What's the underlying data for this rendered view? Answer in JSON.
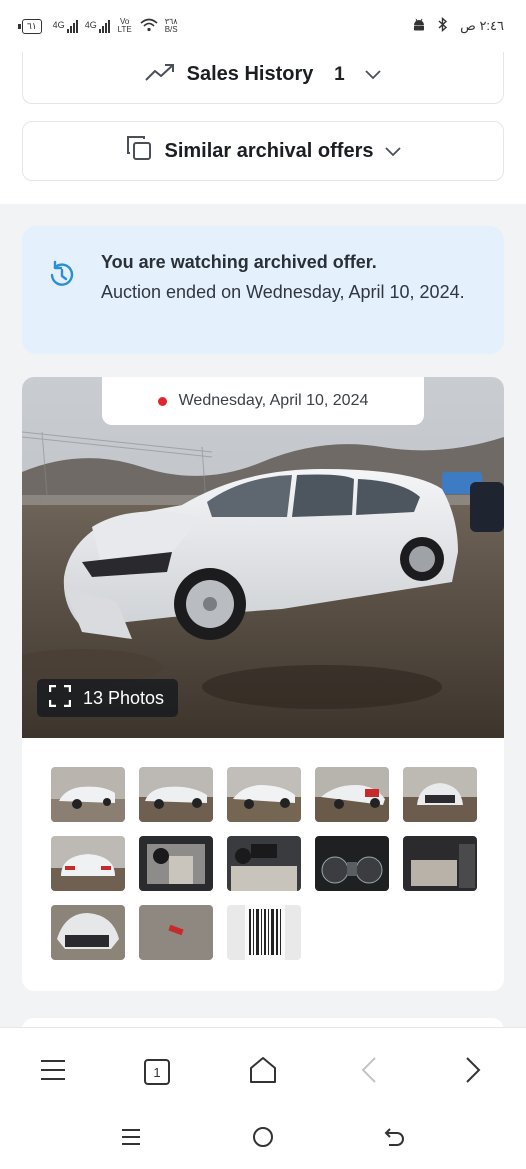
{
  "status_bar": {
    "battery": "٦١",
    "network_1": "4G",
    "network_2": "4G",
    "volte": "Vo LTE",
    "data_speed": "٣٦٨",
    "data_unit": "B/S",
    "time": "٢:٤٦ ص"
  },
  "accordion": {
    "sales_history_label": "Sales History",
    "sales_history_count": "1",
    "similar_offers_label": "Similar archival offers"
  },
  "notice": {
    "title": "You are watching archived offer.",
    "text": "Auction ended on Wednesday, April 10, 2024."
  },
  "gallery": {
    "date": "Wednesday, April 10, 2024",
    "photos_label": "13 Photos",
    "thumbnails": [
      "thumb-front-left",
      "thumb-left",
      "thumb-rear-left",
      "thumb-front-right",
      "thumb-front",
      "thumb-rear",
      "thumb-interior-driver",
      "thumb-dashboard",
      "thumb-gauges",
      "thumb-rear-seats",
      "thumb-front-damage",
      "thumb-ground-part",
      "thumb-label"
    ]
  },
  "browser_bar": {
    "tab_count": "1"
  },
  "colors": {
    "accent_red": "#e0262c",
    "notice_bg": "#e4f1fc",
    "icon_blue": "#2c8ed6"
  }
}
